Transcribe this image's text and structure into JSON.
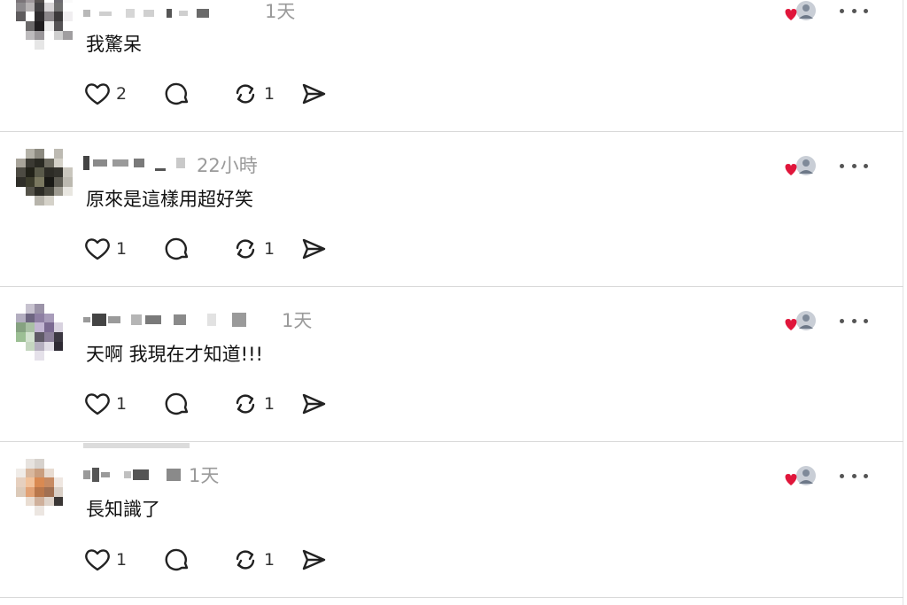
{
  "posts": [
    {
      "timestamp": "1天",
      "text": "我驚呆",
      "actions": {
        "likes": "2",
        "replies": "",
        "reposts": "1"
      }
    },
    {
      "timestamp": "22小時",
      "text": "原來是這樣用超好笑",
      "actions": {
        "likes": "1",
        "replies": "",
        "reposts": "1"
      }
    },
    {
      "timestamp": "1天",
      "text": "天啊 我現在才知道!!!",
      "actions": {
        "likes": "1",
        "replies": "",
        "reposts": "1"
      }
    },
    {
      "timestamp": "1天",
      "text": "長知識了",
      "actions": {
        "likes": "1",
        "replies": "",
        "reposts": "1"
      }
    }
  ],
  "icons": {
    "like": "heart-outline-icon",
    "reply": "speech-bubble-icon",
    "repost": "repost-arrows-icon",
    "share": "send-arrow-icon",
    "more": "more-dots-icon",
    "liked_by_author": "heart-filled-icon"
  },
  "colors": {
    "liked_heart": "#e0163b",
    "muted_text": "#9a9a9a",
    "divider": "#d9d9d9"
  }
}
